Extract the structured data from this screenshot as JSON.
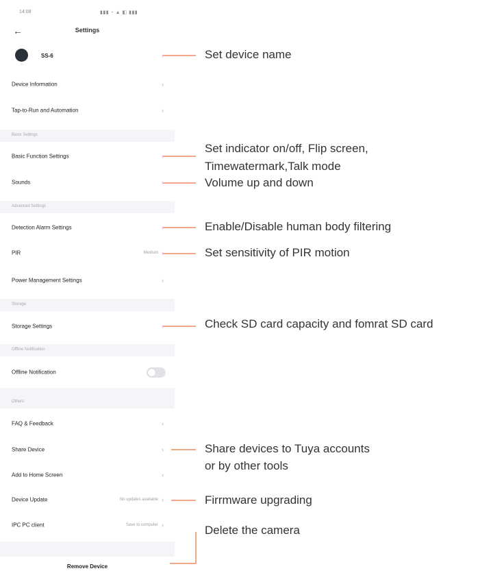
{
  "status_bar": {
    "time": "14:08",
    "icons": "▮▮▮ ◔ ▲ ◧ ▮▮▮"
  },
  "header": {
    "back_icon": "←",
    "title": "Settings"
  },
  "device": {
    "name": "SS-6",
    "chevron": "›"
  },
  "items": {
    "device_information": "Device Information",
    "tap_to_run": "Tap-to-Run and Automation",
    "basic_function": "Basic Function Settings",
    "sounds": "Sounds",
    "detection_alarm": "Detection Alarm Settings",
    "pir": "PIR",
    "pir_value": "Medium",
    "power_management": "Power Management Settings",
    "storage_settings": "Storage Settings",
    "offline_notification": "Offline Notification",
    "faq": "FAQ & Feedback",
    "share_device": "Share Device",
    "add_to_home": "Add to Home Screen",
    "device_update": "Device Update",
    "device_update_value": "No updates available",
    "ipc_pc_client": "IPC PC client",
    "ipc_pc_client_value": "Save to computer",
    "remove_device": "Remove Device",
    "chevron": "›"
  },
  "sections": {
    "basic_settings": "Basic Settings",
    "advanced_settings": "Advanced Settings",
    "storage": "Storage",
    "offline_notification": "Offline Notification",
    "others": "Others"
  },
  "offline_toggle": {
    "on": false
  },
  "annotations": {
    "set_device_name": "Set device name",
    "indicator_line1": "Set indicator on/off, Flip screen,",
    "indicator_line2": "Timewatermark,Talk mode",
    "volume": "Volume up and down",
    "human_body": "Enable/Disable human body filtering",
    "pir_sensitivity": "Set sensitivity of PIR motion",
    "sd_card": "Check SD card capacity and fomrat SD card",
    "share_line1": "Share devices to Tuya accounts",
    "share_line2": "or by other tools",
    "firmware": "Firrmware upgrading",
    "delete": "Delete the camera"
  },
  "colors": {
    "accent_line": "#f5a78a",
    "section_bg": "#f4f5f8",
    "chevron": "#9fb3c7"
  }
}
